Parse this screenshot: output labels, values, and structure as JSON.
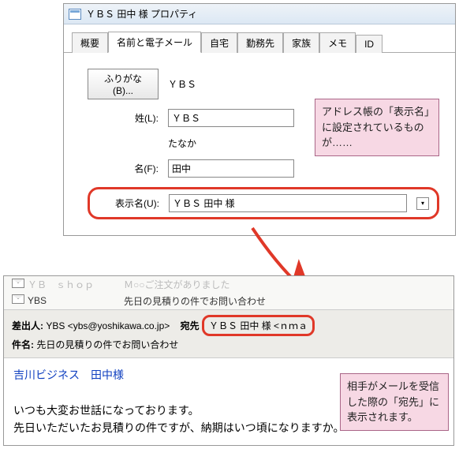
{
  "window": {
    "title": "ＹＢＳ 田中 様 プロパティ"
  },
  "tabs": [
    "概要",
    "名前と電子メール",
    "自宅",
    "勤務先",
    "家族",
    "メモ",
    "ID"
  ],
  "active_tab_index": 1,
  "form": {
    "furigana_btn": "ふりがな(B)...",
    "furigana_value": "ＹＢＳ",
    "last_label": "姓(L):",
    "last_value": "ＹＢＳ",
    "last_furigana": "たなか",
    "first_label": "名(F):",
    "first_value": "田中",
    "display_label": "表示名(U):",
    "display_value": "ＹＢＳ 田中 様"
  },
  "callout1": "アドレス帳の「表示名」に設定されているものが……",
  "callout2": "相手がメールを受信した際の「宛先」に表示されます。",
  "mail_list": [
    {
      "sender": "ＹＢ　ｓｈｏｐ",
      "subject": "Ｍ○○ご注文がありました"
    },
    {
      "sender": "YBS",
      "subject": "先日の見積りの件でお問い合わせ"
    }
  ],
  "mail_header": {
    "from_label": "差出人:",
    "from_value": "YBS <ybs@yoshikawa.co.jp>",
    "to_label": "宛先",
    "to_value": "ＹＢＳ 田中 様 <ｎｍａ",
    "subject_label": "件名:",
    "subject_value": "先日の見積りの件でお問い合わせ"
  },
  "mail_body": {
    "greeting": "吉川ビジネス　田中様",
    "line1": "いつも大変お世話になっております。",
    "line2": "先日いただいたお見積りの件ですが、納期はいつ頃になりますか。"
  }
}
